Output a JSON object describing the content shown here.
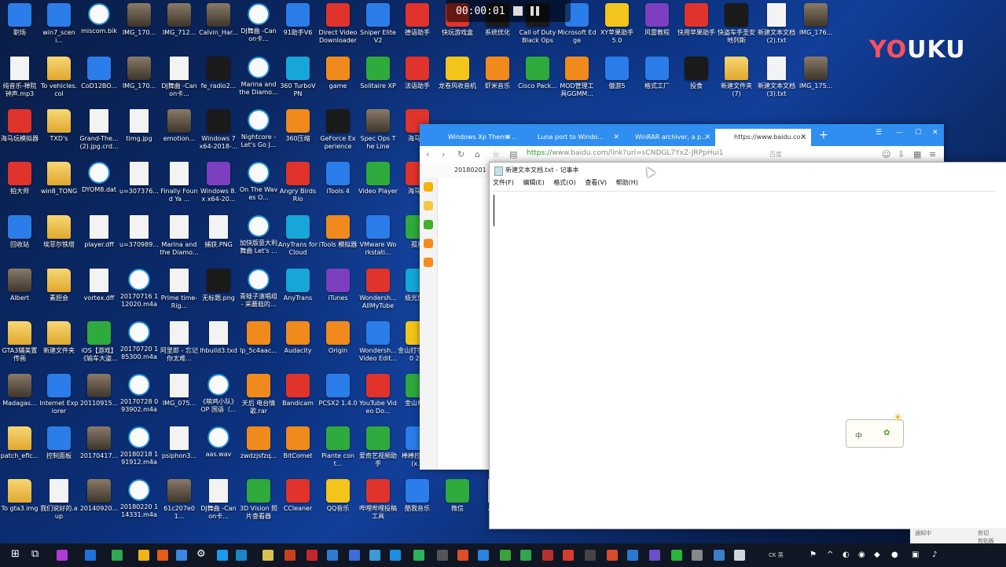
{
  "recorder": {
    "time": "00:00:01"
  },
  "watermark": {
    "yo": "YO",
    "uku": "UKU"
  },
  "desktop_icons": [
    {
      "label": "职场",
      "type": "app"
    },
    {
      "label": "win7_sceni...",
      "type": "app"
    },
    {
      "label": "miscom.bik",
      "type": "media"
    },
    {
      "label": "IMG_170...",
      "type": "photo"
    },
    {
      "label": "IMG_712...",
      "type": "photo"
    },
    {
      "label": "Calvin_Har...",
      "type": "photo"
    },
    {
      "label": "DJ舞曲 -Canon卡...",
      "type": "media"
    },
    {
      "label": "91助手V6",
      "type": "app"
    },
    {
      "label": "Direct Video Downloader",
      "type": "red"
    },
    {
      "label": "Sniper Elite V2",
      "type": "app"
    },
    {
      "label": "德语助手",
      "type": "red"
    },
    {
      "label": "快玩游戏盒",
      "type": "red"
    },
    {
      "label": "系统优化",
      "type": "dark"
    },
    {
      "label": "Call of Duty Black Ops",
      "type": "dark"
    },
    {
      "label": "Microsoft Edge",
      "type": "app"
    },
    {
      "label": "XY苹果助手 5.0",
      "type": "yellow"
    },
    {
      "label": "风雷教程",
      "type": "purple"
    },
    {
      "label": "快用苹果助手",
      "type": "red"
    },
    {
      "label": "快盗车手圣安地列斯",
      "type": "dark"
    },
    {
      "label": "新建文本文档 (2).txt",
      "type": "doc"
    },
    {
      "label": "IMG_176...",
      "type": "photo"
    },
    {
      "label": "纯音乐-禅院钟声.mp3",
      "type": "mp3"
    },
    {
      "label": "To vehicles.col",
      "type": "folder"
    },
    {
      "label": "CoD12BO...",
      "type": "app"
    },
    {
      "label": "IMG_170...",
      "type": "photo"
    },
    {
      "label": "DJ舞曲 -Canon卡...",
      "type": "mp3"
    },
    {
      "label": "fe_radio2...",
      "type": "dark"
    },
    {
      "label": "Marina and the Diamo...",
      "type": "media"
    },
    {
      "label": "360 TurboVPN",
      "type": "cyan"
    },
    {
      "label": "game",
      "type": "orange"
    },
    {
      "label": "Solitaire XP",
      "type": "green"
    },
    {
      "label": "法语助手",
      "type": "red"
    },
    {
      "label": "龙卷风收音机",
      "type": "yellow"
    },
    {
      "label": "虾米音乐",
      "type": "orange"
    },
    {
      "label": "Cisco Pack...",
      "type": "green"
    },
    {
      "label": "MOD管理工具GGMM...",
      "type": "orange"
    },
    {
      "label": "傲游5",
      "type": "app"
    },
    {
      "label": "格式工厂",
      "type": "app"
    },
    {
      "label": "投食",
      "type": "dark"
    },
    {
      "label": "新建文件夹 (7)",
      "type": "folder"
    },
    {
      "label": "新建文本文档 (3).txt",
      "type": "doc"
    },
    {
      "label": "IMG_175...",
      "type": "photo"
    },
    {
      "label": "海马玩模拟器",
      "type": "red"
    },
    {
      "label": "TXD's",
      "type": "folder"
    },
    {
      "label": "Grand-The... (2).jpg.crd...",
      "type": "doc"
    },
    {
      "label": "timg.jpg",
      "type": "doc"
    },
    {
      "label": "emotion...",
      "type": "photo"
    },
    {
      "label": "Windows 7 x64-2018-...",
      "type": "dark"
    },
    {
      "label": "Nightcore - Let's Go J...",
      "type": "media"
    },
    {
      "label": "360压缩",
      "type": "orange"
    },
    {
      "label": "GeForce Experience",
      "type": "dark"
    },
    {
      "label": "Spec Ops The Line",
      "type": "photo"
    },
    {
      "label": "海马玩",
      "type": "red"
    },
    {
      "label": "拍大师",
      "type": "red"
    },
    {
      "label": "win8_TONG",
      "type": "folder"
    },
    {
      "label": "DYOM8.dat",
      "type": "media"
    },
    {
      "label": "u=307376...",
      "type": "doc"
    },
    {
      "label": "Finally Found Ya ...",
      "type": "mp3"
    },
    {
      "label": "Windows 8.x x64-20...",
      "type": "purple"
    },
    {
      "label": "On The Waves O...",
      "type": "media"
    },
    {
      "label": "Angry Birds Rio",
      "type": "red"
    },
    {
      "label": "iTools 4",
      "type": "app"
    },
    {
      "label": "Video Player",
      "type": "green"
    },
    {
      "label": "海马玩",
      "type": "red"
    },
    {
      "label": "回收站",
      "type": "app"
    },
    {
      "label": "埃菲尔铁塔",
      "type": "folder"
    },
    {
      "label": "player.dff",
      "type": "doc"
    },
    {
      "label": "u=370989...",
      "type": "doc"
    },
    {
      "label": "Marina and the Diamo...",
      "type": "mp3"
    },
    {
      "label": "捕获.PNG",
      "type": "doc"
    },
    {
      "label": "加快版意大利舞曲 Let's ...",
      "type": "media"
    },
    {
      "label": "AnyTrans for Cloud",
      "type": "cyan"
    },
    {
      "label": "iTools 模拟器",
      "type": "orange"
    },
    {
      "label": "VMware Workstati...",
      "type": "app"
    },
    {
      "label": "孤星",
      "type": "green"
    },
    {
      "label": "Albert",
      "type": "photo"
    },
    {
      "label": "素胆会",
      "type": "folder"
    },
    {
      "label": "vortex.dff",
      "type": "doc"
    },
    {
      "label": "20170716 112020.m4a",
      "type": "media"
    },
    {
      "label": "Prime time-Rig...",
      "type": "mp3"
    },
    {
      "label": "无标题.png",
      "type": "dark"
    },
    {
      "label": "青蛙子演唱组 - 采蘑菇的...",
      "type": "media"
    },
    {
      "label": "AnyTrans",
      "type": "cyan"
    },
    {
      "label": "iTunes",
      "type": "purple"
    },
    {
      "label": "Wondersh... AllMyTube",
      "type": "red"
    },
    {
      "label": "极光加速",
      "type": "cyan"
    },
    {
      "label": "GTA3辅美置传画",
      "type": "folder"
    },
    {
      "label": "新建文件夹",
      "type": "folder"
    },
    {
      "label": "iOS【游戏】《输车大盗...",
      "type": "green"
    },
    {
      "label": "20170720 185300.m4a",
      "type": "media"
    },
    {
      "label": "阿里郎 - 忘记你太难...",
      "type": "mp3"
    },
    {
      "label": "lhbuild3.txd",
      "type": "doc"
    },
    {
      "label": "lp_5c4aac...",
      "type": "orange"
    },
    {
      "label": "Audacity",
      "type": "orange"
    },
    {
      "label": "Origin",
      "type": "orange"
    },
    {
      "label": "Wondersh... Video Edit...",
      "type": "app"
    },
    {
      "label": "金山打字 2010 2...",
      "type": "yellow"
    },
    {
      "label": "Madagas...",
      "type": "photo"
    },
    {
      "label": "Internet Explorer",
      "type": "app"
    },
    {
      "label": "20110915...",
      "type": "photo"
    },
    {
      "label": "20170728 093902.m4a",
      "type": "media"
    },
    {
      "label": "IMG_075...",
      "type": "doc"
    },
    {
      "label": "《萌鸡小队》OP 国语（...",
      "type": "media"
    },
    {
      "label": "天后 电台情歌.rar",
      "type": "orange"
    },
    {
      "label": "Bandicam",
      "type": "red"
    },
    {
      "label": "PCSX2 1.4.0",
      "type": "app"
    },
    {
      "label": "YouTube Video Do...",
      "type": "red"
    },
    {
      "label": "金山电池",
      "type": "green"
    },
    {
      "label": "patch_eflc...",
      "type": "folder"
    },
    {
      "label": "控制面板",
      "type": "app"
    },
    {
      "label": "20170417...",
      "type": "photo"
    },
    {
      "label": "20180218 191912.m4a",
      "type": "media"
    },
    {
      "label": "psiphon3...",
      "type": "doc"
    },
    {
      "label": "aas.wav",
      "type": "media"
    },
    {
      "label": "zwdzjsfzq...",
      "type": "orange"
    },
    {
      "label": "BitComet",
      "type": "orange"
    },
    {
      "label": "Piante cont...",
      "type": "green"
    },
    {
      "label": "爱奇艺视频助手",
      "type": "green"
    },
    {
      "label": "棒棒控下载(x...",
      "type": "app"
    },
    {
      "label": "To gta3.img",
      "type": "folder"
    },
    {
      "label": "我们说好的.aup",
      "type": "doc"
    },
    {
      "label": "20140920...",
      "type": "photo"
    },
    {
      "label": "20180220 114331.m4a",
      "type": "media"
    },
    {
      "label": "61c207e01...",
      "type": "photo"
    },
    {
      "label": "DJ舞曲 -Canon卡...",
      "type": "mp3"
    },
    {
      "label": "3D Vision 照片查看器",
      "type": "green"
    },
    {
      "label": "CCleaner",
      "type": "red"
    },
    {
      "label": "QQ音乐",
      "type": "yellow"
    },
    {
      "label": "哔哩哔哩投稿工具",
      "type": "red"
    },
    {
      "label": "酷我音乐",
      "type": "app"
    },
    {
      "label": "微信",
      "type": "green"
    },
    {
      "label": "ADS...",
      "type": "doc"
    }
  ],
  "browser": {
    "tabs": [
      "Windows Xp Theme ...",
      "Luna port to Windo...",
      "WinRAR archiver, a p...",
      "https://www.baidu.co..."
    ],
    "new_tab": "+",
    "url_scheme": "https://",
    "url_rest": "www.baidu.com/link?url=sCNDGL7YxZ-JRPpHui1",
    "search_hint": "百度",
    "bookmark": "20180201 ..."
  },
  "notepad": {
    "title": "新建文本文档.txt - 记事本",
    "menu": [
      "文件(F)",
      "编辑(E)",
      "格式(O)",
      "查看(V)",
      "帮助(H)"
    ],
    "ime_label": "中"
  },
  "clipboard": {
    "item1": "通知中",
    "item2": "剪切",
    "item3": "剪贴板"
  },
  "taskbar": {
    "tray_lang": "CK",
    "tray_input": "英",
    "clock": ""
  }
}
